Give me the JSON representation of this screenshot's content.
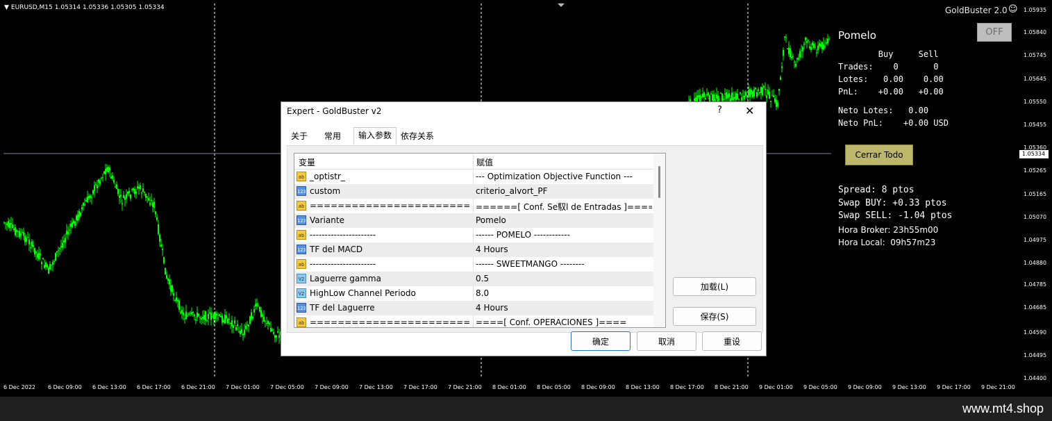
{
  "chart": {
    "symbol_bar": {
      "symbol": "EURUSD,M15",
      "open": "1.05314",
      "high": "1.05336",
      "low": "1.05305",
      "close": "1.05334"
    },
    "current_price": "1.05334",
    "price_axis": [
      "1.05935",
      "1.05840",
      "1.05745",
      "1.05645",
      "1.05550",
      "1.05455",
      "1.05360",
      "1.05265",
      "1.05165",
      "1.05070",
      "1.04975",
      "1.04880",
      "1.04785",
      "1.04685",
      "1.04590",
      "1.04495",
      "1.04400"
    ],
    "time_axis": [
      "6 Dec 2022",
      "6 Dec 09:00",
      "6 Dec 13:00",
      "6 Dec 17:00",
      "6 Dec 21:00",
      "7 Dec 01:00",
      "7 Dec 05:00",
      "7 Dec 09:00",
      "7 Dec 13:00",
      "7 Dec 17:00",
      "7 Dec 21:00",
      "8 Dec 01:00",
      "8 Dec 05:00",
      "8 Dec 09:00",
      "8 Dec 13:00",
      "8 Dec 17:00",
      "8 Dec 21:00",
      "9 Dec 01:00",
      "9 Dec 05:00",
      "9 Dec 09:00",
      "9 Dec 13:00",
      "9 Dec 17:00",
      "9 Dec 21:00"
    ],
    "candle_color": "#00ff00",
    "background": "#000000"
  },
  "ea_panel": {
    "title": "GoldBuster 2.0",
    "smiley_icon": "☺",
    "name": "Pomelo",
    "toggle_label": "OFF",
    "header_line": "        Buy     Sell",
    "trades_line": "Trades:    0       0",
    "lotes_line": "Lotes:   0.00    0.00",
    "pnl_line": "PnL:    +0.00   +0.00",
    "neto_lotes_line": "Neto Lotes:   0.00",
    "neto_pnl_line": "Neto PnL:    +0.00 USD",
    "close_all_label": "Cerrar Todo",
    "spread_line": "Spread: 8 ptos",
    "swap_buy_line": "Swap BUY: +0.33 ptos",
    "swap_sell_line": "Swap SELL: -1.04 ptos",
    "hora_broker_line": "Hora Broker: 23h55m00",
    "hora_local_line": "Hora Local:  09h57m23",
    "button_color": "#bdb76b"
  },
  "dialog": {
    "title": "Expert - GoldBuster v2",
    "help_label": "?",
    "close_label": "✕",
    "tabs": [
      "关于",
      "常用",
      "输入参数",
      "依存关系"
    ],
    "active_tab": "输入参数",
    "columns": [
      "变量",
      "赋值"
    ],
    "rows": [
      {
        "icon": "ab",
        "var": "_optistr_",
        "val": " --- Optimization Objective Function ---"
      },
      {
        "icon": "int",
        "var": "custom",
        "val": "criterio_alvort_PF"
      },
      {
        "icon": "ab",
        "var": "========================...",
        "val": "======[ Conf. Se馭l de Entradas ]===="
      },
      {
        "icon": "int",
        "var": "Variante",
        "val": "Pomelo"
      },
      {
        "icon": "ab",
        "var": "----------------------",
        "val": "------ POMELO ------------"
      },
      {
        "icon": "int",
        "var": "TF del MACD",
        "val": "4 Hours"
      },
      {
        "icon": "ab",
        "var": "----------------------",
        "val": "------ SWEETMANGO --------"
      },
      {
        "icon": "dbl",
        "var": "Laguerre gamma",
        "val": "0.5"
      },
      {
        "icon": "dbl",
        "var": "HighLow Channel Periodo",
        "val": "8.0"
      },
      {
        "icon": "int",
        "var": "TF del Laguerre",
        "val": "4 Hours"
      },
      {
        "icon": "ab",
        "var": "========================...",
        "val": "====[ Conf. OPERACIONES ]===="
      }
    ],
    "load_label": "加载(L)",
    "save_label": "保存(S)",
    "ok_label": "确定",
    "cancel_label": "取消",
    "reset_label": "重设"
  },
  "footer": {
    "text": "www.mt4.shop"
  }
}
